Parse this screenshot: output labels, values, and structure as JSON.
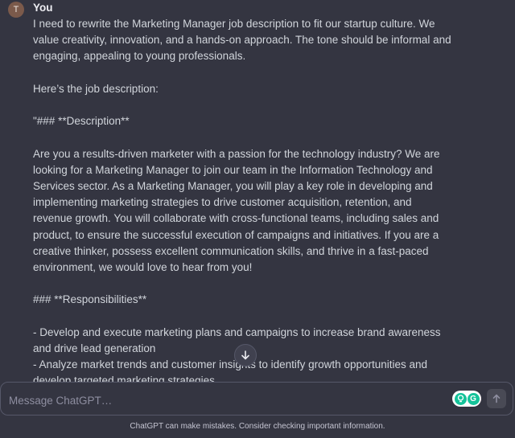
{
  "message": {
    "avatar_initial": "T",
    "author": "You",
    "paragraphs": [
      "I need to rewrite the Marketing Manager job description to fit our startup culture. We value creativity, innovation, and a hands-on approach. The tone should be informal and engaging, appealing to young professionals.",
      "Here’s the job description:",
      "\"### **Description**",
      "Are you a results-driven marketer with a passion for the technology industry? We are looking for a Marketing Manager to join our team in the Information Technology and Services sector. As a Marketing Manager, you will play a key role in developing and implementing marketing strategies to drive customer acquisition, retention, and revenue growth. You will collaborate with cross-functional teams, including sales and product, to ensure the successful execution of campaigns and initiatives. If you are a creative thinker, possess excellent communication skills, and thrive in a fast-paced environment, we would love to hear from you!",
      "### **Responsibilities**",
      "- Develop and execute marketing plans and campaigns to increase brand awareness and drive lead generation\n- Analyze market trends and customer insights to identify growth opportunities and develop targeted marketing strategies"
    ]
  },
  "composer": {
    "placeholder": "Message ChatGPT…",
    "grammarly_letter": "G"
  },
  "footer": {
    "disclaimer": "ChatGPT can make mistakes. Consider checking important information."
  },
  "icons": {
    "scroll_down": "arrow-down-icon",
    "send": "arrow-up-icon",
    "grammarly": "grammarly-icon"
  }
}
